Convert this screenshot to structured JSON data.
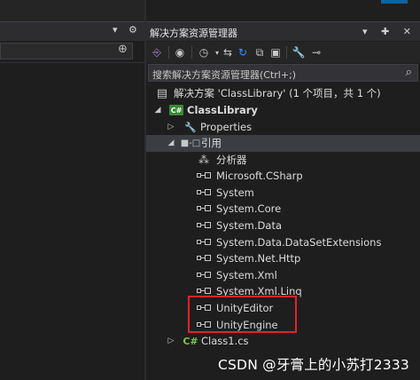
{
  "solution_explorer": {
    "title": "解决方案资源管理器",
    "search_placeholder": "搜索解决方案资源管理器(Ctrl+;)",
    "tree": {
      "solution": "解决方案 'ClassLibrary' (1 个项目，共 1 个)",
      "project": "ClassLibrary",
      "properties": "Properties",
      "references": "引用",
      "ref_items": [
        "分析器",
        "Microsoft.CSharp",
        "System",
        "System.Core",
        "System.Data",
        "System.Data.DataSetExtensions",
        "System.Net.Http",
        "System.Xml",
        "System.Xml.Linq",
        "UnityEditor",
        "UnityEngine"
      ],
      "file": "Class1.cs"
    }
  },
  "icons": {
    "solution": "solution-icon",
    "project": "csharp-project-icon",
    "properties": "wrench-icon",
    "references": "references-icon",
    "assembly": "assembly-reference-icon",
    "analyzer": "analyzer-icon",
    "file": "csharp-file-icon"
  },
  "colors": {
    "background": "#1e1e1e",
    "highlight_box": "#e0242b",
    "csharp_green": "#388a34"
  },
  "watermark": "CSDN @牙膏上的小苏打2333"
}
